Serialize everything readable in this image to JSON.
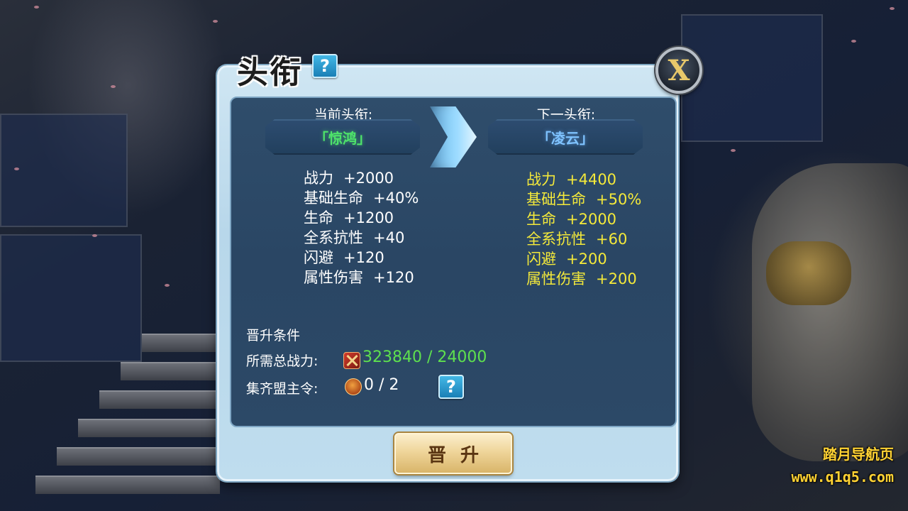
{
  "dialog": {
    "title": "头衔",
    "help_glyph": "?",
    "close_glyph": "X"
  },
  "current_title": {
    "label": "当前头衔:",
    "name": "「惊鸿」",
    "color": "#4ee36a",
    "stats": [
      {
        "name": "战力",
        "value": "+2000"
      },
      {
        "name": "基础生命",
        "value": "+40%"
      },
      {
        "name": "生命",
        "value": "+1200"
      },
      {
        "name": "全系抗性",
        "value": "+40"
      },
      {
        "name": "闪避",
        "value": "+120"
      },
      {
        "name": "属性伤害",
        "value": "+120"
      }
    ]
  },
  "next_title": {
    "label": "下一头衔:",
    "name": "「凌云」",
    "color": "#7fc3ff",
    "stat_color": "#f4e93a",
    "stats": [
      {
        "name": "战力",
        "value": "+4400"
      },
      {
        "name": "基础生命",
        "value": "+50%"
      },
      {
        "name": "生命",
        "value": "+2000"
      },
      {
        "name": "全系抗性",
        "value": "+60"
      },
      {
        "name": "闪避",
        "value": "+200"
      },
      {
        "name": "属性伤害",
        "value": "+200"
      }
    ]
  },
  "conditions": {
    "title": "晋升条件",
    "power_label": "所需总战力:",
    "power_value": "323840 / 24000",
    "power_icon": "crossed-swords-icon",
    "token_label": "集齐盟主令:",
    "token_value": "0 / 2",
    "token_icon": "alliance-token-icon",
    "help_glyph": "?"
  },
  "promote_button": {
    "label": "晋升"
  },
  "watermark": {
    "line1": "踏月导航页",
    "line2": "www.q1q5.com"
  },
  "colors": {
    "panel": "#2c4967",
    "frame": "#bfddee",
    "power_value": "#5ee04e",
    "button_gold": "#efd59a",
    "watermark": "#ffd233"
  }
}
